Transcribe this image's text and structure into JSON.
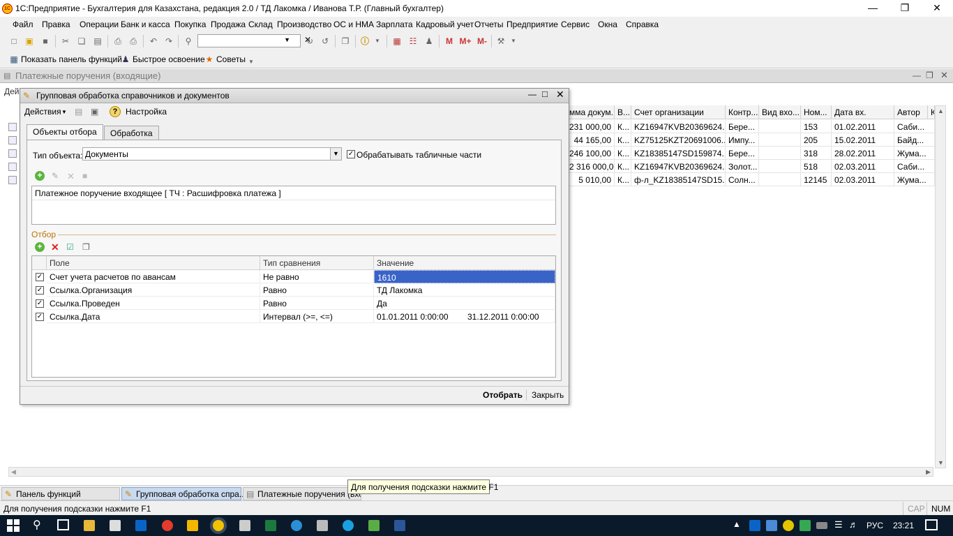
{
  "window": {
    "title": "1С:Предприятие - Бухгалтерия для Казахстана, редакция 2.0 / ТД Лакомка / Иванова Т.Р. (Главный бухгалтер)",
    "logo": "1С"
  },
  "menu": [
    "Файл",
    "Правка",
    "Операции",
    "Банк и касса",
    "Покупка",
    "Продажа",
    "Склад",
    "Производство",
    "ОС и НМА",
    "Зарплата",
    "Кадровый учет",
    "Отчеты",
    "Предприятие",
    "Сервис",
    "Окна",
    "Справка"
  ],
  "toolbar2": {
    "show_panel": "Показать панель функций",
    "quick": "Быстрое освоение",
    "tips": "Советы"
  },
  "toolbar1": {
    "m": "M",
    "mplus": "M+",
    "mminus": "M-"
  },
  "docwin": {
    "title": "Платежные поручения (входящие)",
    "actions": "Дей",
    "columns": [
      "мма докум...",
      "В...",
      "Счет организации",
      "Контр...",
      "Вид вхо...",
      "Ном...",
      "Дата вх.",
      "Автор",
      "К"
    ],
    "rows": [
      [
        "231 000,00",
        "К...",
        "KZ16947KVB20369624...",
        "Бере...",
        "",
        "153",
        "01.02.2011",
        "Саби..."
      ],
      [
        "44 165,00",
        "К...",
        "KZ75125KZT20691006...",
        "Импу...",
        "",
        "205",
        "15.02.2011",
        "Байд..."
      ],
      [
        "246 100,00",
        "К...",
        "KZ18385147SD159874...",
        "Бере...",
        "",
        "318",
        "28.02.2011",
        "Жума..."
      ],
      [
        "2 316 000,00",
        "К...",
        "KZ16947KVB20369624...",
        "Золот...",
        "",
        "518",
        "02.03.2011",
        "Саби..."
      ],
      [
        "5 010,00",
        "К...",
        "ф-л_KZ18385147SD15...",
        "Солн...",
        "",
        "12145",
        "02.03.2011",
        "Жума..."
      ]
    ]
  },
  "dialog": {
    "title": "Групповая обработка справочников и документов",
    "actions": "Действия",
    "settings": "Настройка",
    "tabs": [
      "Объекты отбора",
      "Обработка"
    ],
    "object_type_label": "Тип объекта:",
    "object_type_value": "Документы",
    "process_tables": "Обрабатывать табличные части",
    "object_item": "Платежное поручение входящее [ ТЧ : Расшифровка платежа ]",
    "filter_label": "Отбор",
    "grid_headers": [
      "Поле",
      "Тип сравнения",
      "Значение"
    ],
    "grid_rows": [
      {
        "field": "Счет учета расчетов по авансам",
        "cmp": "Не равно",
        "value": "1610",
        "value2": ""
      },
      {
        "field": "Ссылка.Организация",
        "cmp": "Равно",
        "value": "ТД Лакомка",
        "value2": ""
      },
      {
        "field": "Ссылка.Проведен",
        "cmp": "Равно",
        "value": "Да",
        "value2": ""
      },
      {
        "field": "Ссылка.Дата",
        "cmp": "Интервал (>=, <=)",
        "value": "01.01.2011 0:00:00",
        "value2": "31.12.2011 0:00:00"
      }
    ],
    "btn_select": "Отобрать",
    "btn_close": "Закрыть"
  },
  "mditabs": [
    "Панель функций",
    "Групповая обработка спра...",
    "Платежные поручения (вхо..."
  ],
  "tooltip": "Для получения подсказки нажмите F1",
  "status": {
    "hint": "Для получения подсказки нажмите F1",
    "cap": "CAP",
    "num": "NUM"
  },
  "taskbar": {
    "lang": "РУС",
    "time": "23:21"
  }
}
